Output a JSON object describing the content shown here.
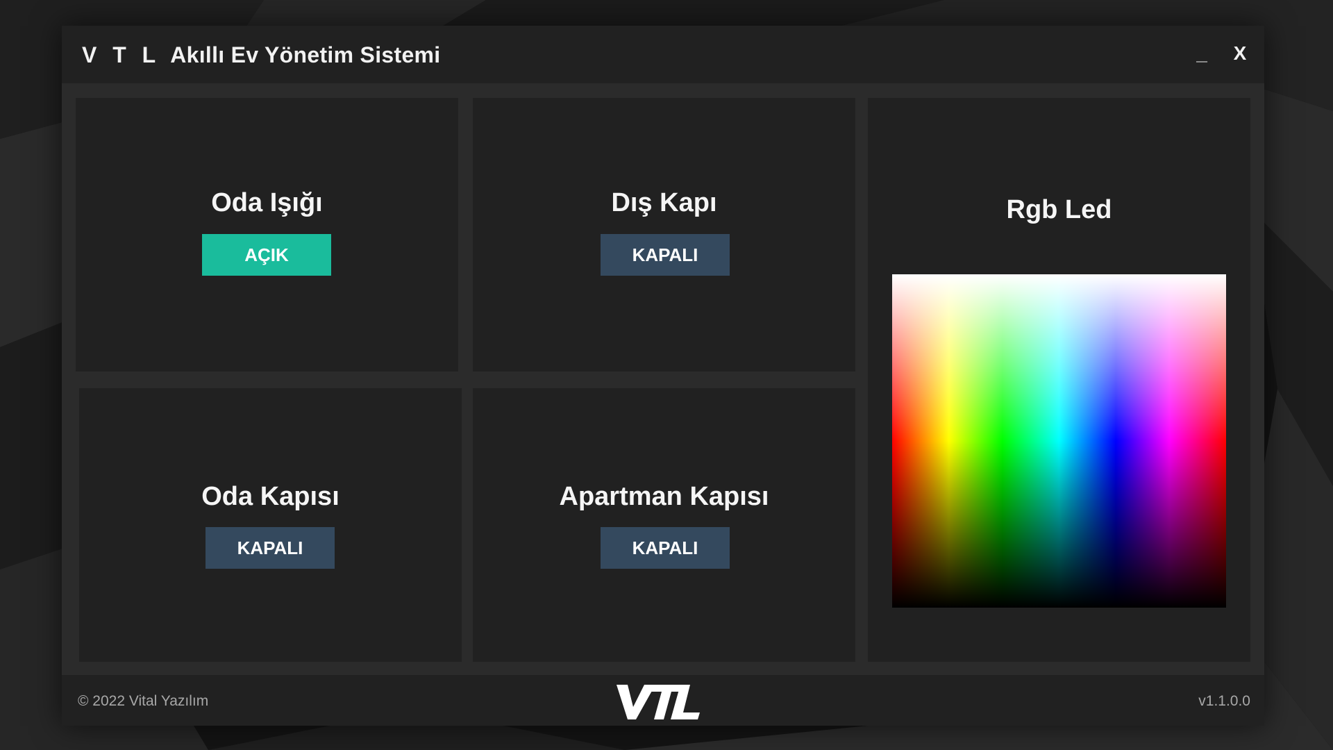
{
  "window": {
    "brand": "V T L",
    "title": "Akıllı Ev Yönetim Sistemi",
    "minimize_label": "_",
    "close_label": "X"
  },
  "panels": {
    "oda_isigi": {
      "title": "Oda Işığı",
      "state_label": "AÇIK",
      "state": "on"
    },
    "dis_kapi": {
      "title": "Dış Kapı",
      "state_label": "KAPALI",
      "state": "off"
    },
    "oda_kapisi": {
      "title": "Oda Kapısı",
      "state_label": "KAPALI",
      "state": "off"
    },
    "apartman_kapisi": {
      "title": "Apartman Kapısı",
      "state_label": "KAPALI",
      "state": "off"
    },
    "rgb_led": {
      "title": "Rgb Led"
    }
  },
  "footer": {
    "copyright": "© 2022 Vital Yazılım",
    "logo_text": "VTL",
    "version": "v1.1.0.0"
  },
  "colors": {
    "on": "#1abc9c",
    "off": "#34495e",
    "panel": "#212121",
    "window": "#2b2b2b"
  }
}
